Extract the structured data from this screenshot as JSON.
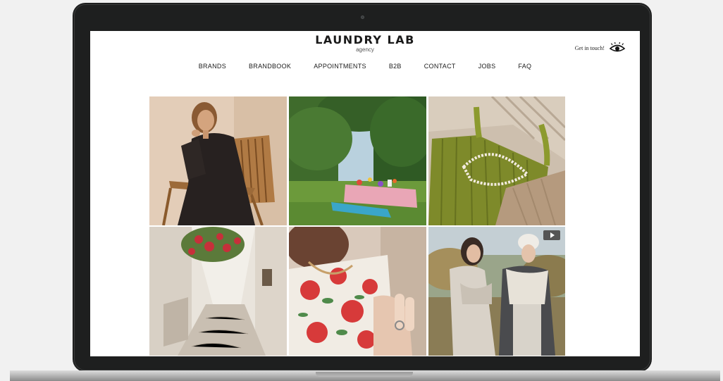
{
  "header": {
    "logo_title": "LAUNDRY LAB",
    "logo_subtitle": "agency",
    "contact_label": "Get in touch!"
  },
  "nav": {
    "items": [
      "BRANDS",
      "BRANDBOOK",
      "APPOINTMENTS",
      "B2B",
      "CONTACT",
      "JOBS",
      "FAQ"
    ]
  },
  "icons": {
    "contact": "eye-icon",
    "video": "play-icon"
  },
  "colors": {
    "laptop_frame": "#1e1f1f",
    "page_bg": "#ffffff",
    "text": "#1a1a1a"
  }
}
